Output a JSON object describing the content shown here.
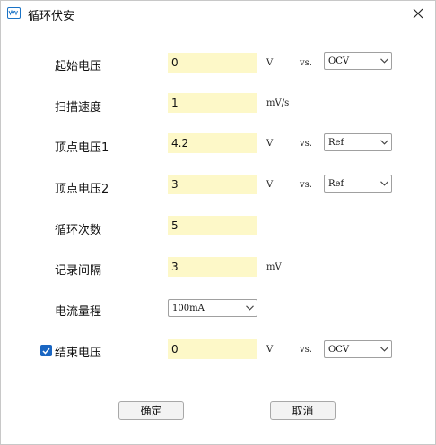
{
  "window": {
    "title": "循环伏安",
    "app_icon": "potentiostat-app-icon",
    "close_icon": "close-icon"
  },
  "rows": {
    "start_potential": {
      "label": "起始电压",
      "value": "0",
      "unit": "V",
      "vs": "vs.",
      "ref": "OCV"
    },
    "scan_rate": {
      "label": "扫描速度",
      "value": "1",
      "unit": "mV/s"
    },
    "vertex1": {
      "label": "顶点电压1",
      "value": "4.2",
      "unit": "V",
      "vs": "vs.",
      "ref": "Ref"
    },
    "vertex2": {
      "label": "顶点电压2",
      "value": "3",
      "unit": "V",
      "vs": "vs.",
      "ref": "Ref"
    },
    "cycles": {
      "label": "循环次数",
      "value": "5"
    },
    "record_interval": {
      "label": "记录间隔",
      "value": "3",
      "unit": "mV"
    },
    "current_range": {
      "label": "电流量程",
      "selected": "100mA"
    },
    "end_potential": {
      "label": "结束电压",
      "checked": true,
      "value": "0",
      "unit": "V",
      "vs": "vs.",
      "ref": "OCV"
    }
  },
  "buttons": {
    "ok": "确定",
    "cancel": "取消"
  },
  "colors": {
    "field_bg": "#fdf8c8",
    "accent": "#1a66c2"
  }
}
